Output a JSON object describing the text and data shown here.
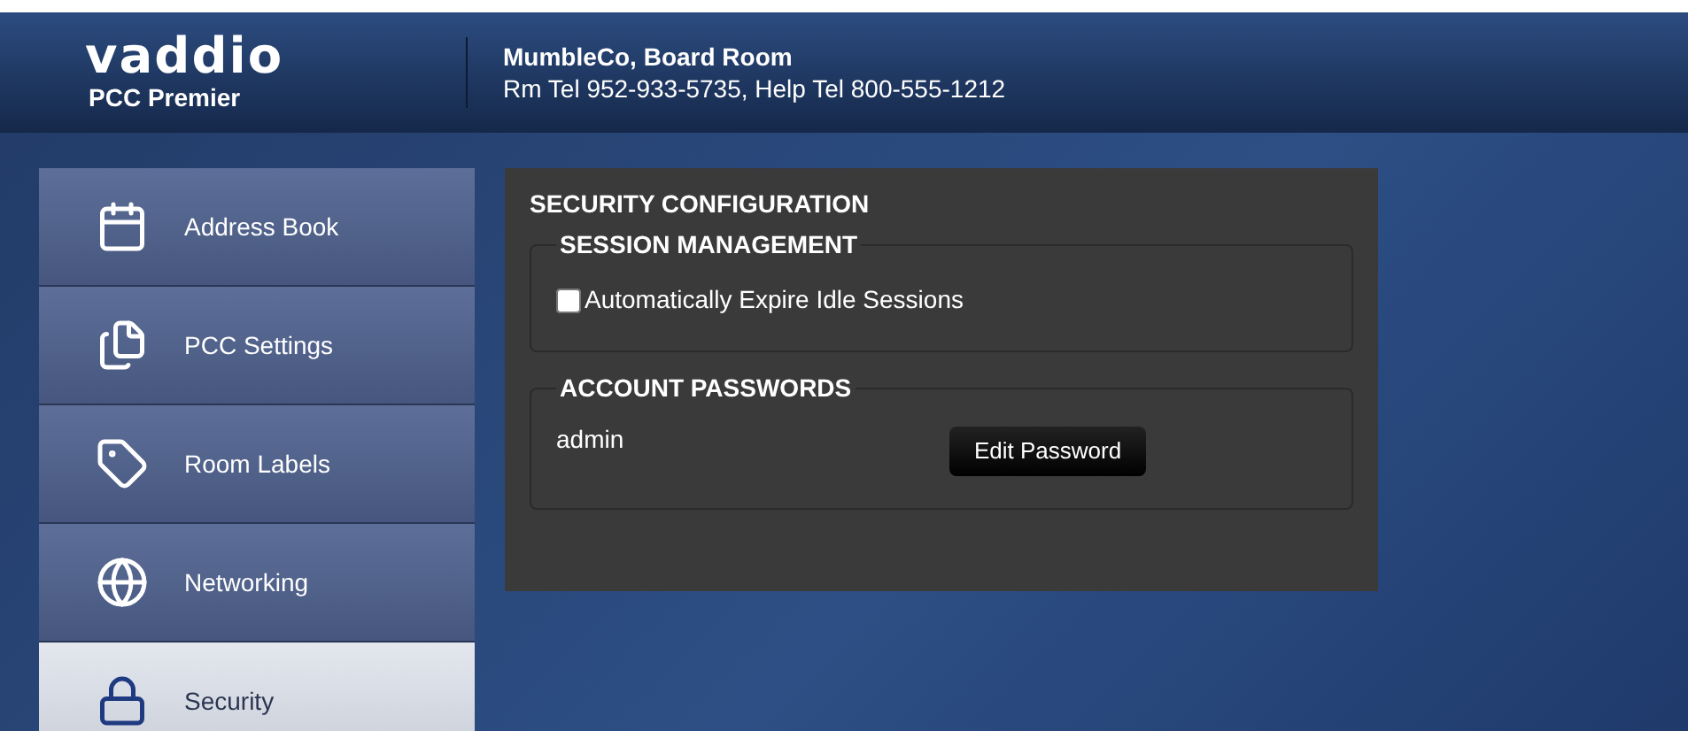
{
  "header": {
    "logo": "vaddio",
    "product": "PCC Premier",
    "room": "MumbleCo, Board Room",
    "phones": "Rm Tel 952-933-5735, Help Tel 800-555-1212"
  },
  "sidebar": {
    "items": [
      {
        "label": "Address Book",
        "selected": false
      },
      {
        "label": "PCC Settings",
        "selected": false
      },
      {
        "label": "Room Labels",
        "selected": false
      },
      {
        "label": "Networking",
        "selected": false
      },
      {
        "label": "Security",
        "selected": true
      }
    ]
  },
  "panel": {
    "title": "SECURITY CONFIGURATION",
    "session": {
      "legend": "SESSION MANAGEMENT",
      "checkbox": {
        "label": "Automatically Expire Idle Sessions",
        "checked": false
      }
    },
    "accounts": {
      "legend": "ACCOUNT PASSWORDS",
      "rows": [
        {
          "user": "admin",
          "button": "Edit Password"
        }
      ]
    }
  }
}
